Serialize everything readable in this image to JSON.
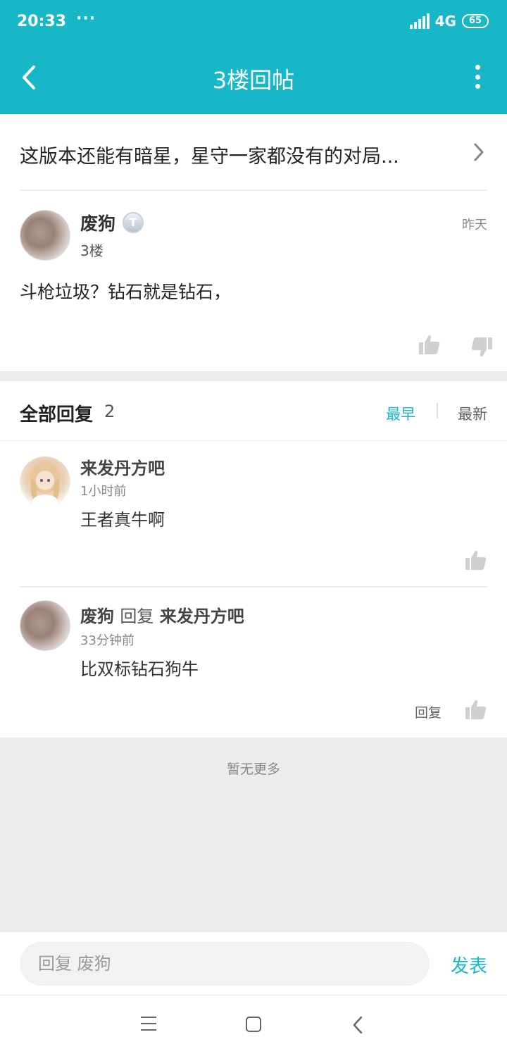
{
  "status_bar": {
    "time": "20:33",
    "dots": "···",
    "network": "4G",
    "battery": "65"
  },
  "nav": {
    "title": "3楼回帖",
    "back_icon": "chevron-left-icon",
    "more_icon": "more-vertical-icon"
  },
  "thread": {
    "title": "这版本还能有暗星，星守一家都没有的对局..."
  },
  "floor_post": {
    "author": "废狗",
    "badge": "T",
    "floor": "3楼",
    "time": "昨天",
    "content": "斗枪垃圾？钻石就是钻石，"
  },
  "replies_header": {
    "title": "全部回复",
    "count": "2",
    "sort_earliest": "最早",
    "sort_newest": "最新"
  },
  "replies": [
    {
      "author": "来发丹方吧",
      "time": "1小时前",
      "content": "王者真牛啊"
    },
    {
      "author": "废狗",
      "reply_verb": "回复",
      "target": "来发丹方吧",
      "time": "33分钟前",
      "content": "比双标钻石狗牛",
      "action": "回复"
    }
  ],
  "footer_note": "暂无更多",
  "input_bar": {
    "placeholder": "回复 废狗",
    "send_label": "发表"
  },
  "colors": {
    "accent": "#17b7c8",
    "page_gray": "#ececec"
  }
}
